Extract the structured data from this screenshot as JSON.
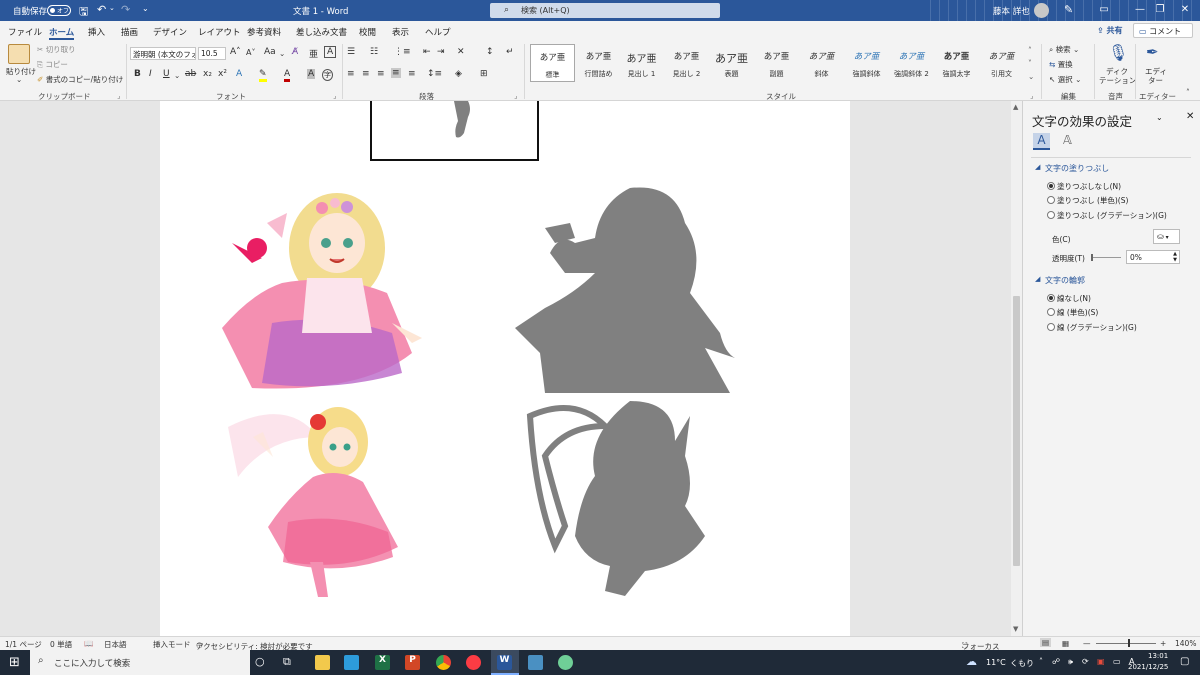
{
  "titlebar": {
    "autosave_label": "自動保存",
    "autosave_state": "オフ",
    "doc_title": "文書 1  -  Word",
    "search_placeholder": "検索 (Alt+Q)",
    "user_name": "藤本 詳也"
  },
  "tabs": [
    "ファイル",
    "ホーム",
    "挿入",
    "描画",
    "デザイン",
    "レイアウト",
    "参考資料",
    "差し込み文書",
    "校閲",
    "表示",
    "ヘルプ"
  ],
  "active_tab": "ホーム",
  "tab_actions": {
    "share": "共有",
    "comment": "コメント"
  },
  "clipboard": {
    "paste": "貼り付け",
    "cut": "切り取り",
    "copy": "コピー",
    "format_painter": "書式のコピー/貼り付け",
    "group": "クリップボード"
  },
  "font": {
    "name": "游明朝 (本文のフォ",
    "size": "10.5",
    "change_case": "Aa",
    "group": "フォント"
  },
  "paragraph": {
    "group": "段落"
  },
  "styles": {
    "group": "スタイル",
    "items": [
      {
        "sample": "あア亜",
        "name": "標準"
      },
      {
        "sample": "あア亜",
        "name": "行間詰め"
      },
      {
        "sample": "あア亜",
        "name": "見出し 1"
      },
      {
        "sample": "あア亜",
        "name": "見出し 2"
      },
      {
        "sample": "あア亜",
        "name": "表題"
      },
      {
        "sample": "あア亜",
        "name": "副題"
      },
      {
        "sample": "あア亜",
        "name": "斜体"
      },
      {
        "sample": "あア亜",
        "name": "強調斜体"
      },
      {
        "sample": "あア亜",
        "name": "強調斜体 2"
      },
      {
        "sample": "あア亜",
        "name": "強調太字"
      },
      {
        "sample": "あア亜",
        "name": "引用文"
      }
    ]
  },
  "editing": {
    "find": "検索",
    "replace": "置換",
    "select": "選択",
    "group": "編集"
  },
  "voice": {
    "dictate_line1": "ディク",
    "dictate_line2": "テーション",
    "group": "音声"
  },
  "editor": {
    "line1": "エディ",
    "line2": "ター",
    "group": "エディター"
  },
  "pane": {
    "title": "文字の効果の設定",
    "fill_section": "文字の塗りつぶし",
    "fill_options": [
      "塗りつぶしなし(N)",
      "塗りつぶし (単色)(S)",
      "塗りつぶし (グラデーション)(G)"
    ],
    "fill_selected": 0,
    "color_label": "色(C)",
    "transparency_label": "透明度(T)",
    "transparency_value": "0%",
    "outline_section": "文字の輪郭",
    "outline_options": [
      "線なし(N)",
      "線 (単色)(S)",
      "線 (グラデーション)(G)"
    ],
    "outline_selected": 0
  },
  "status": {
    "page": "1/1 ページ",
    "words": "0 単語",
    "language": "日本語",
    "mode": "挿入モード",
    "accessibility": "アクセシビリティ: 検討が必要です",
    "focus": "フォーカス",
    "zoom": "140%"
  },
  "taskbar": {
    "search_placeholder": "ここに入力して検索",
    "temperature": "11°C",
    "weather": "くもり",
    "ime": "A",
    "time": "13:01",
    "date": "2021/12/25"
  },
  "colors": {
    "title_blue": "#2b579a",
    "silhouette_gray": "#808080",
    "taskbar": "#1f2a38"
  }
}
